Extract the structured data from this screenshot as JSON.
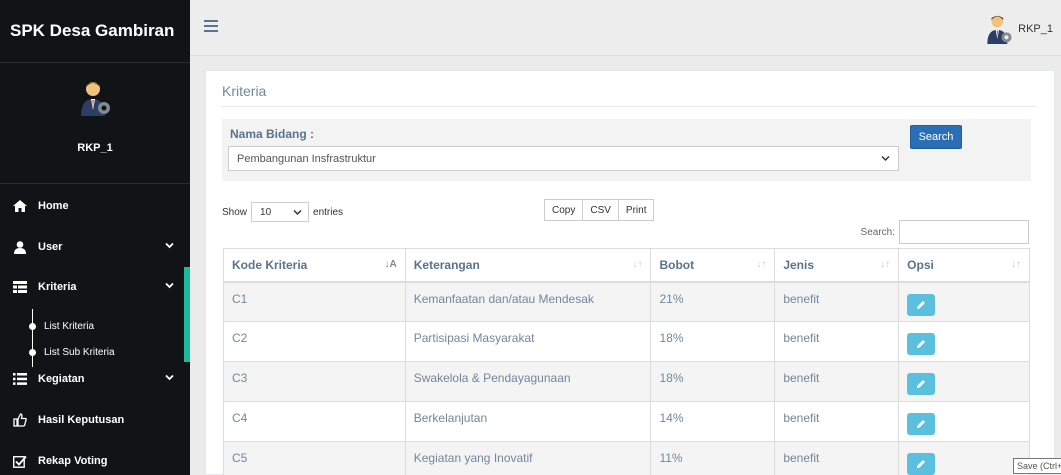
{
  "sidebar": {
    "brand": "SPK Desa Gambiran",
    "username": "RKP_1",
    "items": [
      {
        "label": "Home",
        "icon": "home-icon"
      },
      {
        "label": "User",
        "icon": "user-icon"
      },
      {
        "label": "Kriteria",
        "icon": "table-icon"
      },
      {
        "label": "Kegiatan",
        "icon": "list-icon"
      },
      {
        "label": "Hasil Keputusan",
        "icon": "thumbs-up-icon"
      },
      {
        "label": "Rekap Voting",
        "icon": "checkbox-icon"
      }
    ],
    "sub_items": [
      {
        "label": "List Kriteria"
      },
      {
        "label": "List Sub Kriteria"
      }
    ],
    "active_color": "#1abc9c"
  },
  "topbar": {
    "username": "RKP_1"
  },
  "panel": {
    "title": "Kriteria",
    "filter": {
      "label": "Nama Bidang :",
      "selected": "Pembangunan Insfrastruktur",
      "search_label": "Search"
    },
    "length": {
      "show_label": "Show",
      "value": "10",
      "entries_label": "entries"
    },
    "buttons": [
      "Copy",
      "CSV",
      "Print"
    ],
    "search_label": "Search:",
    "table": {
      "headers": [
        "Kode Kriteria",
        "Keterangan",
        "Bobot",
        "Jenis",
        "Opsi"
      ],
      "rows": [
        [
          "C1",
          "Kemanfaatan dan/atau Mendesak",
          "21%",
          "benefit"
        ],
        [
          "C2",
          "Partisipasi Masyarakat",
          "18%",
          "benefit"
        ],
        [
          "C3",
          "Swakelola & Pendayagunaan",
          "18%",
          "benefit"
        ],
        [
          "C4",
          "Berkelanjutan",
          "14%",
          "benefit"
        ],
        [
          "C5",
          "Kegiatan yang Inovatif",
          "11%",
          "benefit"
        ]
      ]
    }
  },
  "tooltip": "Save (Ctrl+",
  "colors": {
    "sidebar_bg": "#111417",
    "search_button": "#2a6fb6",
    "edit_button": "#5bc0de"
  }
}
